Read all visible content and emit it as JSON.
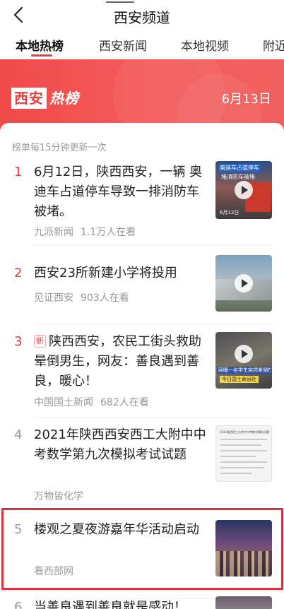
{
  "header": {
    "title": "西安频道"
  },
  "tabs": [
    "本地热榜",
    "西安新闻",
    "本地视频",
    "附近"
  ],
  "banner": {
    "title_box": "西安",
    "title_rest": "热榜",
    "date": "6月13日"
  },
  "list": {
    "update_note": "榜单每15分钟更新一次",
    "items": [
      {
        "rank": "1",
        "title": "6月12日，陕西西安，一辆 奥迪车占道停车导致一排消防车被堵。",
        "source": "九派新闻",
        "heat": "1.1万人在看",
        "thumb_caption": "奥迪车占道停车",
        "thumb_sub": "堵消防车被堵",
        "thumb_date": "6月12日"
      },
      {
        "rank": "2",
        "title": "西安23所新建小学将投用",
        "source": "见证西安",
        "heat": "903人在看"
      },
      {
        "rank": "3",
        "badge": "新",
        "title": "陕西西安，农民工街头救助晕倒男生，网友：善良遇到善良，暖心！",
        "source": "中国国土新闻",
        "heat": "682人在看",
        "thumb_caption": "网曝一名学生突然晕倒在地",
        "thumb_sub": "今日国土命运社"
      },
      {
        "rank": "4",
        "title": "2021年陕西西安西工大附中中考数学第九次模拟考试试题",
        "source": "万物皆化学",
        "thumb_caption": "2021陕西西工大附中中考数学模拟试题"
      },
      {
        "rank": "5",
        "title": "楼观之夏夜游嘉年华活动启动",
        "source": "看西部网"
      },
      {
        "rank": "6",
        "title": "当善良遇到善良就是感动！"
      }
    ]
  },
  "colors": {
    "accent": "#e8403f",
    "highlight": "#d9333f"
  }
}
